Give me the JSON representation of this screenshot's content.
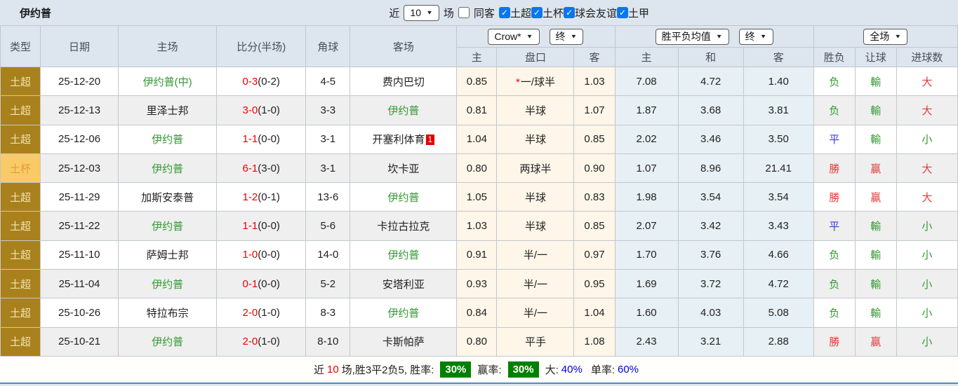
{
  "title": "伊约普",
  "topbar": {
    "recent_label": "近",
    "recent_value": "10",
    "matches_label": "场",
    "same_away_label": "同客",
    "filters": [
      {
        "label": "土超",
        "checked": true
      },
      {
        "label": "土杯",
        "checked": true
      },
      {
        "label": "球会友谊",
        "checked": true
      },
      {
        "label": "土甲",
        "checked": true
      }
    ]
  },
  "table": {
    "columns": [
      "类型",
      "日期",
      "主场",
      "比分(半场)",
      "角球",
      "客场"
    ],
    "selects": {
      "bookmaker": "Crow*",
      "bookmaker_time": "终",
      "avg": "胜平负均值",
      "avg_time": "终",
      "scope": "全场"
    },
    "sub_headers": [
      "主",
      "盘口",
      "客",
      "主",
      "和",
      "客",
      "胜负",
      "让球",
      "进球数"
    ],
    "rows": [
      {
        "league": "土超",
        "is_cup": false,
        "date": "25-12-20",
        "home": "伊约普(中)",
        "home_is_team": true,
        "score": "0-3",
        "half_score": "(0-2)",
        "corners": "4-5",
        "away": "费内巴切",
        "away_is_team": false,
        "away_badge": "",
        "odds_home": "0.85",
        "handicap": "一/球半",
        "handicap_star": true,
        "odds_away": "1.03",
        "avg_home": "7.08",
        "avg_draw": "4.72",
        "avg_away": "1.40",
        "outcome": {
          "text": "负",
          "color": "g"
        },
        "handicap_outcome": {
          "text": "輸",
          "color": "g"
        },
        "goals_outcome": {
          "text": "大",
          "color": "r"
        }
      },
      {
        "league": "土超",
        "is_cup": false,
        "date": "25-12-13",
        "home": "里泽士邦",
        "home_is_team": false,
        "score": "3-0",
        "half_score": "(1-0)",
        "corners": "3-3",
        "away": "伊约普",
        "away_is_team": true,
        "away_badge": "",
        "odds_home": "0.81",
        "handicap": "半球",
        "handicap_star": false,
        "odds_away": "1.07",
        "avg_home": "1.87",
        "avg_draw": "3.68",
        "avg_away": "3.81",
        "outcome": {
          "text": "负",
          "color": "g"
        },
        "handicap_outcome": {
          "text": "輸",
          "color": "g"
        },
        "goals_outcome": {
          "text": "大",
          "color": "r"
        }
      },
      {
        "league": "土超",
        "is_cup": false,
        "date": "25-12-06",
        "home": "伊约普",
        "home_is_team": true,
        "score": "1-1",
        "half_score": "(0-0)",
        "corners": "3-1",
        "away": "开塞利体育",
        "away_is_team": false,
        "away_badge": "1",
        "odds_home": "1.04",
        "handicap": "半球",
        "handicap_star": false,
        "odds_away": "0.85",
        "avg_home": "2.02",
        "avg_draw": "3.46",
        "avg_away": "3.50",
        "outcome": {
          "text": "平",
          "color": "b"
        },
        "handicap_outcome": {
          "text": "輸",
          "color": "g"
        },
        "goals_outcome": {
          "text": "小",
          "color": "g"
        }
      },
      {
        "league": "土杯",
        "is_cup": true,
        "date": "25-12-03",
        "home": "伊约普",
        "home_is_team": true,
        "score": "6-1",
        "half_score": "(3-0)",
        "corners": "3-1",
        "away": "坎卡亚",
        "away_is_team": false,
        "away_badge": "",
        "odds_home": "0.80",
        "handicap": "两球半",
        "handicap_star": false,
        "odds_away": "0.90",
        "avg_home": "1.07",
        "avg_draw": "8.96",
        "avg_away": "21.41",
        "outcome": {
          "text": "勝",
          "color": "r"
        },
        "handicap_outcome": {
          "text": "贏",
          "color": "r"
        },
        "goals_outcome": {
          "text": "大",
          "color": "r"
        }
      },
      {
        "league": "土超",
        "is_cup": false,
        "date": "25-11-29",
        "home": "加斯安泰普",
        "home_is_team": false,
        "score": "1-2",
        "half_score": "(0-1)",
        "corners": "13-6",
        "away": "伊约普",
        "away_is_team": true,
        "away_badge": "",
        "odds_home": "1.05",
        "handicap": "半球",
        "handicap_star": false,
        "odds_away": "0.83",
        "avg_home": "1.98",
        "avg_draw": "3.54",
        "avg_away": "3.54",
        "outcome": {
          "text": "勝",
          "color": "r"
        },
        "handicap_outcome": {
          "text": "贏",
          "color": "r"
        },
        "goals_outcome": {
          "text": "大",
          "color": "r"
        }
      },
      {
        "league": "土超",
        "is_cup": false,
        "date": "25-11-22",
        "home": "伊约普",
        "home_is_team": true,
        "score": "1-1",
        "half_score": "(0-0)",
        "corners": "5-6",
        "away": "卡拉古拉克",
        "away_is_team": false,
        "away_badge": "",
        "odds_home": "1.03",
        "handicap": "半球",
        "handicap_star": false,
        "odds_away": "0.85",
        "avg_home": "2.07",
        "avg_draw": "3.42",
        "avg_away": "3.43",
        "outcome": {
          "text": "平",
          "color": "b"
        },
        "handicap_outcome": {
          "text": "輸",
          "color": "g"
        },
        "goals_outcome": {
          "text": "小",
          "color": "g"
        }
      },
      {
        "league": "土超",
        "is_cup": false,
        "date": "25-11-10",
        "home": "萨姆士邦",
        "home_is_team": false,
        "score": "1-0",
        "half_score": "(0-0)",
        "corners": "14-0",
        "away": "伊约普",
        "away_is_team": true,
        "away_badge": "",
        "odds_home": "0.91",
        "handicap": "半/一",
        "handicap_star": false,
        "odds_away": "0.97",
        "avg_home": "1.70",
        "avg_draw": "3.76",
        "avg_away": "4.66",
        "outcome": {
          "text": "负",
          "color": "g"
        },
        "handicap_outcome": {
          "text": "輸",
          "color": "g"
        },
        "goals_outcome": {
          "text": "小",
          "color": "g"
        }
      },
      {
        "league": "土超",
        "is_cup": false,
        "date": "25-11-04",
        "home": "伊约普",
        "home_is_team": true,
        "score": "0-1",
        "half_score": "(0-0)",
        "corners": "5-2",
        "away": "安塔利亚",
        "away_is_team": false,
        "away_badge": "",
        "odds_home": "0.93",
        "handicap": "半/一",
        "handicap_star": false,
        "odds_away": "0.95",
        "avg_home": "1.69",
        "avg_draw": "3.72",
        "avg_away": "4.72",
        "outcome": {
          "text": "负",
          "color": "g"
        },
        "handicap_outcome": {
          "text": "輸",
          "color": "g"
        },
        "goals_outcome": {
          "text": "小",
          "color": "g"
        }
      },
      {
        "league": "土超",
        "is_cup": false,
        "date": "25-10-26",
        "home": "特拉布宗",
        "home_is_team": false,
        "score": "2-0",
        "half_score": "(1-0)",
        "corners": "8-3",
        "away": "伊约普",
        "away_is_team": true,
        "away_badge": "",
        "odds_home": "0.84",
        "handicap": "半/一",
        "handicap_star": false,
        "odds_away": "1.04",
        "avg_home": "1.60",
        "avg_draw": "4.03",
        "avg_away": "5.08",
        "outcome": {
          "text": "负",
          "color": "g"
        },
        "handicap_outcome": {
          "text": "輸",
          "color": "g"
        },
        "goals_outcome": {
          "text": "小",
          "color": "g"
        }
      },
      {
        "league": "土超",
        "is_cup": false,
        "date": "25-10-21",
        "home": "伊约普",
        "home_is_team": true,
        "score": "2-0",
        "half_score": "(1-0)",
        "corners": "8-10",
        "away": "卡斯帕萨",
        "away_is_team": false,
        "away_badge": "",
        "odds_home": "0.80",
        "handicap": "平手",
        "handicap_star": false,
        "odds_away": "1.08",
        "avg_home": "2.43",
        "avg_draw": "3.21",
        "avg_away": "2.88",
        "outcome": {
          "text": "勝",
          "color": "r"
        },
        "handicap_outcome": {
          "text": "贏",
          "color": "r"
        },
        "goals_outcome": {
          "text": "小",
          "color": "g"
        }
      }
    ]
  },
  "summary": {
    "recent_label": "近",
    "recent_count": "10",
    "stats_text": "场,胜3平2负5, 胜率:",
    "win_rate": "30%",
    "profit_label": "赢率:",
    "profit_rate": "30%",
    "big_label": "大:",
    "big_value": "40%",
    "single_label": "单率:",
    "single_value": "60%"
  },
  "colors": {
    "league_super_bg": "#a8811d",
    "league_cup_bg": "#f8cb66",
    "team_green": "#339933",
    "score_red": "#f00000",
    "win_red": "#e03c3c",
    "lose_green": "#339933",
    "draw_blue": "#3b3bd8",
    "rate_badge_green": "#008000",
    "percent_blue": "#0000dd",
    "page_bg": "#dde5ee"
  }
}
